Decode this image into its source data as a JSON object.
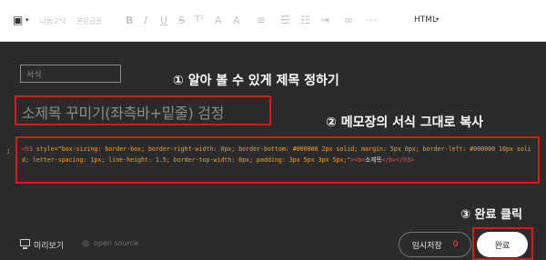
{
  "toolbar": {
    "image_icon": "image-icon",
    "font_label": "나눔고딕",
    "size_label": "본문글꼴",
    "bold": "B",
    "italic": "I",
    "underline": "U",
    "strike": "S",
    "superscript": "T²",
    "font_color": "A",
    "highlight": "A",
    "mode_label": "HTML"
  },
  "editor": {
    "format_select": "서식",
    "title_text": "소제목 꾸미기(좌측바+밑줄) 검정",
    "line_number": "1",
    "code": {
      "open_tag": "<h3 ",
      "style_attr": "style=\"box-sizing: border-box; border-right-width: 0px; border-bottom: #000000 2px solid; margin: 5px 0px; border-left: #000000 10px solid; letter-spacing: 1px; line-height: 1.5; border-top-width: 0px; padding: 3px 5px 3px 5px;\"",
      "b_open": "><b>",
      "text": "소제목",
      "close_tags": "</b></h3>"
    }
  },
  "annotations": {
    "step1": "① 알아 볼 수 있게 제목 정하기",
    "step2": "② 메모장의 서식 그대로 복사",
    "step3": "③ 완료 클릭"
  },
  "footer": {
    "preview_label": "미리보기",
    "open_source_label": "open source",
    "save_draft_label": "임시저장",
    "save_draft_count": "0",
    "done_label": "완료"
  },
  "colors": {
    "highlight_frame": "#e01818",
    "code_attr": "#e8a33a",
    "code_tag": "#d95b5b",
    "background": "#2b2b2b"
  }
}
